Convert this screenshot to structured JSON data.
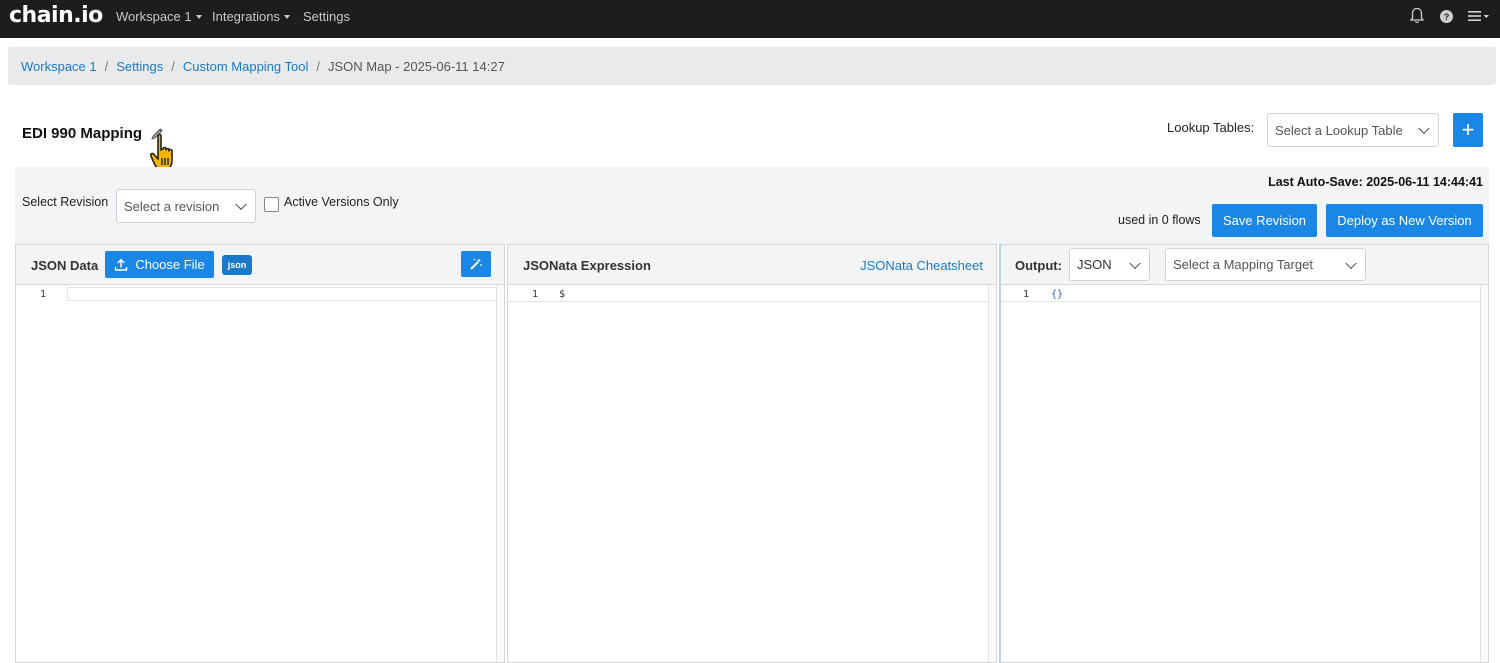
{
  "nav": {
    "logo": "chain.io",
    "workspace": "Workspace 1",
    "integrations": "Integrations",
    "settings": "Settings"
  },
  "breadcrumb": {
    "items": [
      "Workspace 1",
      "Settings",
      "Custom Mapping Tool"
    ],
    "current": "JSON Map - 2025-06-11 14:27"
  },
  "page": {
    "title": "EDI 990 Mapping",
    "lookup_label": "Lookup Tables:",
    "lookup_placeholder": "Select a Lookup Table",
    "add_label": "+"
  },
  "revision": {
    "label": "Select Revision",
    "placeholder": "Select a revision",
    "active_only_label": "Active Versions Only",
    "active_only_checked": false,
    "autosave": "Last Auto-Save: 2025-06-11 14:44:41",
    "used_in": "used in 0 flows",
    "save_label": "Save Revision",
    "deploy_label": "Deploy as New Version"
  },
  "panels": {
    "json_data": {
      "title": "JSON Data",
      "choose_file": "Choose File",
      "badge": "json",
      "line_no": "1",
      "content": ""
    },
    "expression": {
      "title": "JSONata Expression",
      "cheatsheet": "JSONata Cheatsheet",
      "line_no": "1",
      "content": "$"
    },
    "output": {
      "title": "Output:",
      "format": "JSON",
      "target_placeholder": "Select a Mapping Target",
      "line_no": "1",
      "content": "{}"
    }
  },
  "colors": {
    "accent": "#1a87e6",
    "link": "#1a7ac9",
    "nav_bg": "#1d1d1d"
  }
}
